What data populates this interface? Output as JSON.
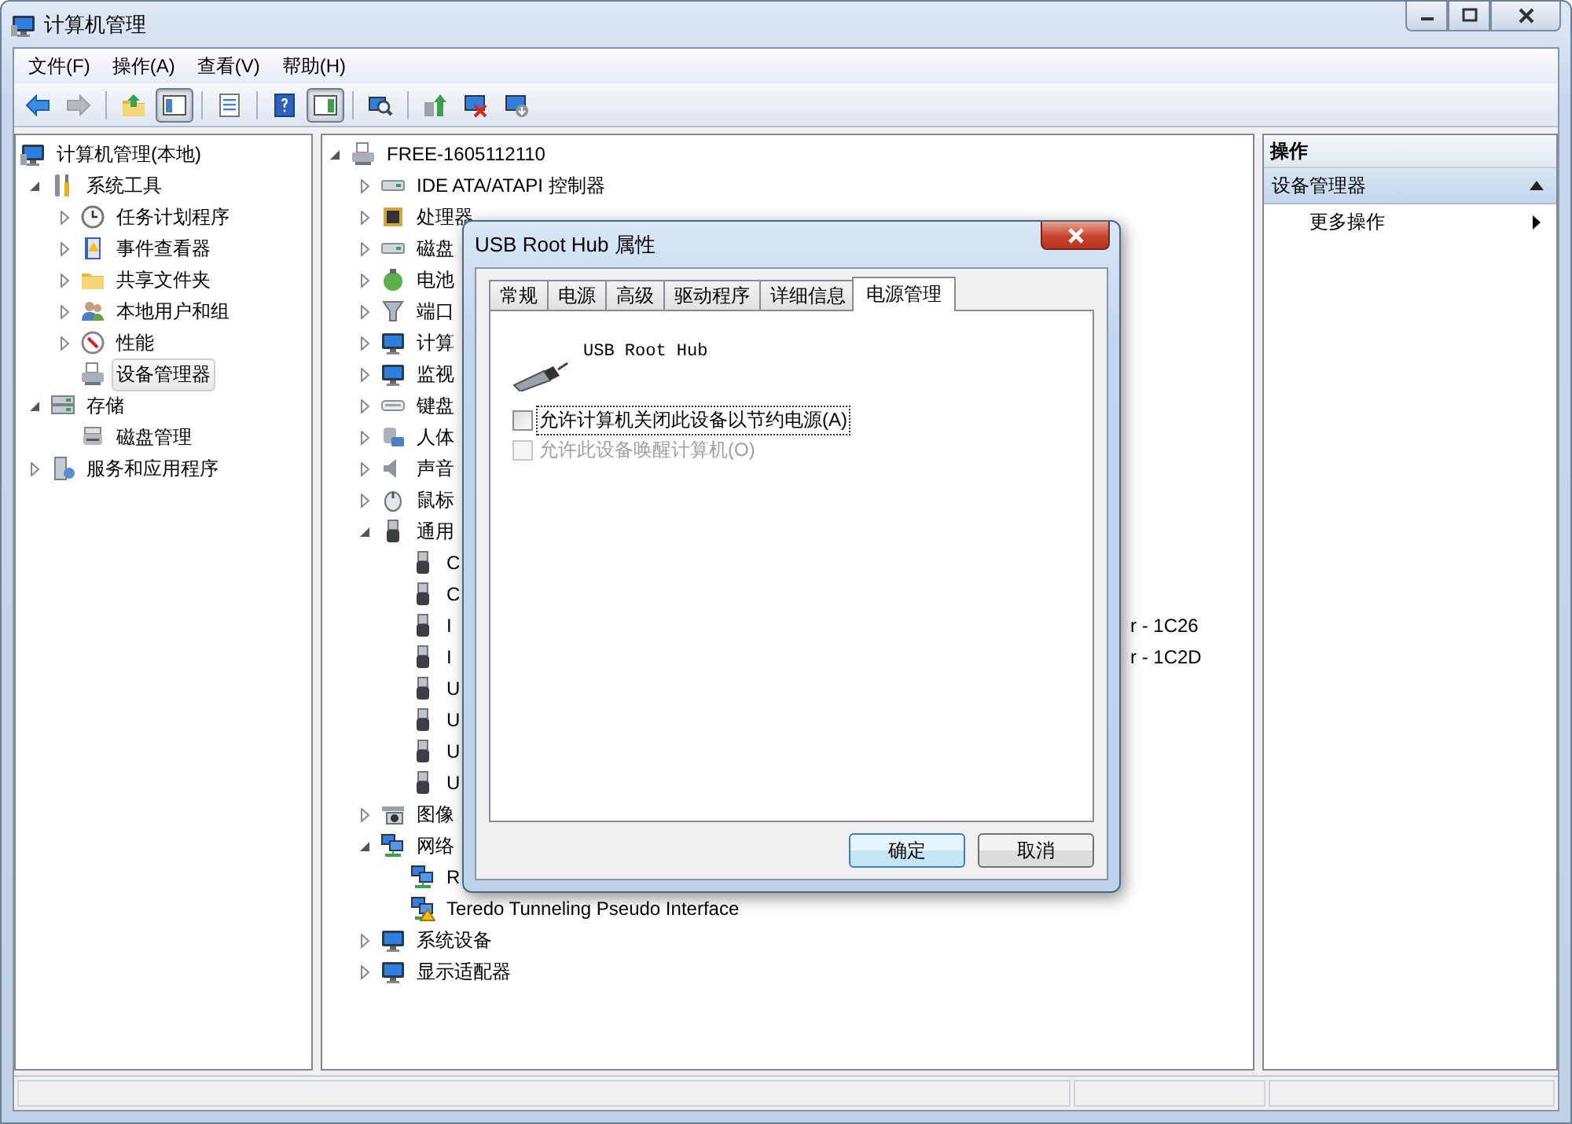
{
  "window": {
    "title": "计算机管理"
  },
  "menu": [
    "文件(F)",
    "操作(A)",
    "查看(V)",
    "帮助(H)"
  ],
  "toolbar": [
    {
      "on": false,
      "disabled": false
    },
    {
      "on": false,
      "disabled": true
    },
    {
      "on": false,
      "disabled": false
    },
    {
      "on": true,
      "disabled": false
    },
    {
      "on": false,
      "disabled": false
    },
    {
      "on": false,
      "disabled": false
    },
    {
      "on": true,
      "disabled": false
    },
    {
      "on": false,
      "disabled": false
    },
    {
      "on": false,
      "disabled": false
    },
    {
      "on": false,
      "disabled": false
    },
    {
      "on": false,
      "disabled": false
    }
  ],
  "left_tree": {
    "root": {
      "label": "计算机管理(本地)",
      "selected": false
    },
    "items": [
      {
        "label": "系统工具",
        "expanded": true,
        "selected": false,
        "children": [
          {
            "label": "任务计划程序",
            "expanded": false,
            "selected": false
          },
          {
            "label": "事件查看器",
            "expanded": false,
            "selected": false
          },
          {
            "label": "共享文件夹",
            "expanded": false,
            "selected": false
          },
          {
            "label": "本地用户和组",
            "expanded": false,
            "selected": false
          },
          {
            "label": "性能",
            "expanded": false,
            "selected": false
          },
          {
            "label": "设备管理器",
            "selected": true
          }
        ]
      },
      {
        "label": "存储",
        "expanded": true,
        "selected": false,
        "children": [
          {
            "label": "磁盘管理",
            "selected": false
          }
        ]
      },
      {
        "label": "服务和应用程序",
        "expanded": false,
        "selected": false
      }
    ]
  },
  "device_tree": {
    "items": [
      {
        "label": "FREE-1605112110",
        "expanded": true,
        "children": [
          {
            "label": "IDE ATA/ATAPI 控制器",
            "expanded": false
          },
          {
            "label": "处理器",
            "expanded": false
          },
          {
            "label": "磁盘",
            "expanded": false
          },
          {
            "label": "电池",
            "expanded": false
          },
          {
            "label": "端口",
            "expanded": false
          },
          {
            "label": "计算",
            "expanded": false
          },
          {
            "label": "监视",
            "expanded": false
          },
          {
            "label": "键盘",
            "expanded": false
          },
          {
            "label": "人体",
            "expanded": false
          },
          {
            "label": "声音",
            "expanded": false
          },
          {
            "label": "鼠标",
            "expanded": false
          },
          {
            "label": "通用",
            "expanded": true,
            "children": [
              {
                "label": "C"
              },
              {
                "label": "C"
              },
              {
                "label": "I",
                "label_end": "r - 1C26"
              },
              {
                "label": "I",
                "label_end": "r - 1C2D"
              },
              {
                "label": "U"
              },
              {
                "label": "U"
              },
              {
                "label": "U"
              },
              {
                "label": "U"
              }
            ]
          },
          {
            "label": "图像",
            "expanded": false
          },
          {
            "label": "网络",
            "expanded": true,
            "children": [
              {
                "label": "R"
              },
              {
                "label": "Teredo Tunneling Pseudo Interface"
              }
            ]
          },
          {
            "label": "系统设备",
            "expanded": false
          },
          {
            "label": "显示适配器",
            "expanded": false
          }
        ]
      }
    ]
  },
  "actions": {
    "title": "操作",
    "section": {
      "label": "设备管理器",
      "expanded": true
    },
    "items": [
      {
        "label": "更多操作"
      }
    ]
  },
  "dialog": {
    "title": "USB Root Hub 属性",
    "tabs": [
      {
        "label": "常规",
        "selected": false
      },
      {
        "label": "电源",
        "selected": false
      },
      {
        "label": "高级",
        "selected": false
      },
      {
        "label": "驱动程序",
        "selected": false
      },
      {
        "label": "详细信息",
        "selected": false
      },
      {
        "label": "电源管理",
        "selected": true
      }
    ],
    "device_name": "USB Root Hub",
    "options": [
      {
        "label": "允许计算机关闭此设备以节约电源(A)",
        "checked": false,
        "disabled": false,
        "focused": true
      },
      {
        "label": "允许此设备唤醒计算机(O)",
        "checked": false,
        "disabled": true,
        "focused": false
      }
    ],
    "buttons": [
      {
        "label": "确定",
        "default": true
      },
      {
        "label": "取消",
        "default": false
      }
    ]
  }
}
